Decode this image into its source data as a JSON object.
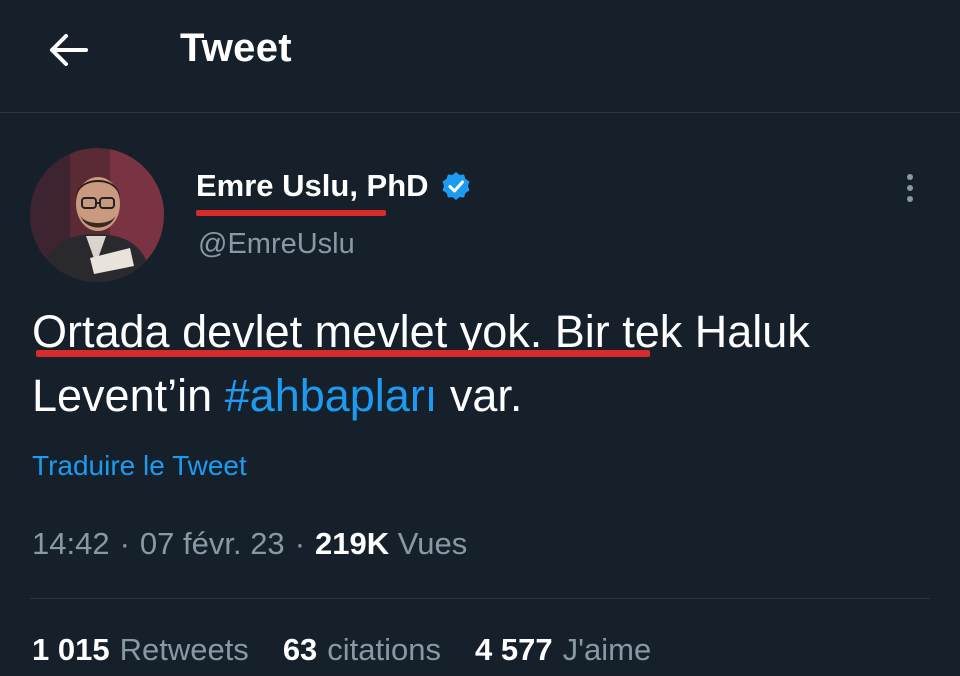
{
  "header": {
    "title": "Tweet"
  },
  "author": {
    "display_name": "Emre Uslu, PhD",
    "handle": "@EmreUslu",
    "verified": true
  },
  "tweet": {
    "text_before": "Ortada devlet mevlet yok. Bir tek Haluk Levent’in ",
    "hashtag": "#ahbapları",
    "text_after": " var.",
    "translate_label": "Traduire le Tweet"
  },
  "meta": {
    "time": "14:42",
    "date": "07 févr. 23",
    "views_count": "219K",
    "views_label": "Vues",
    "separator": "·"
  },
  "stats": {
    "retweets_count": "1 015",
    "retweets_label": "Retweets",
    "quotes_count": "63",
    "quotes_label": "citations",
    "likes_count": "4 577",
    "likes_label": "J'aime"
  },
  "colors": {
    "background": "#15202b",
    "accent": "#1d9bf0",
    "secondary_text": "#8899a6",
    "highlight_underline": "#d72a2a"
  },
  "icons": {
    "back": "arrow-left-icon",
    "verified": "verified-badge-icon",
    "more": "more-vertical-icon"
  }
}
